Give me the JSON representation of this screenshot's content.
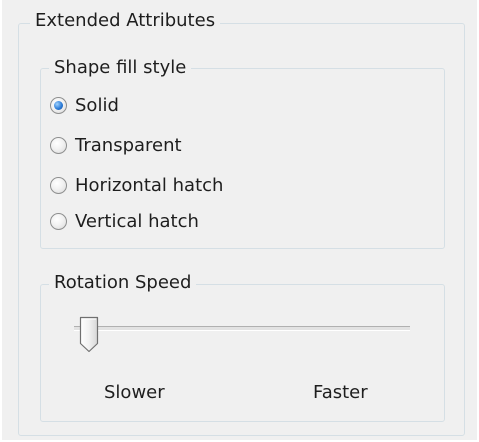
{
  "groups": {
    "extended": {
      "title": "Extended Attributes"
    },
    "fill": {
      "title": "Shape fill style",
      "options": [
        {
          "label": "Solid",
          "checked": true
        },
        {
          "label": "Transparent",
          "checked": false
        },
        {
          "label": "Horizontal hatch",
          "checked": false
        },
        {
          "label": "Vertical hatch",
          "checked": false
        }
      ]
    },
    "speed": {
      "title": "Rotation Speed",
      "slider": {
        "value_fraction": 0.0,
        "min_label": "Slower",
        "max_label": "Faster"
      }
    }
  },
  "colors": {
    "panel_background": "#f0f0f0",
    "group_border": "#d5dfe5",
    "radio_selected": "#2f7ed8"
  }
}
